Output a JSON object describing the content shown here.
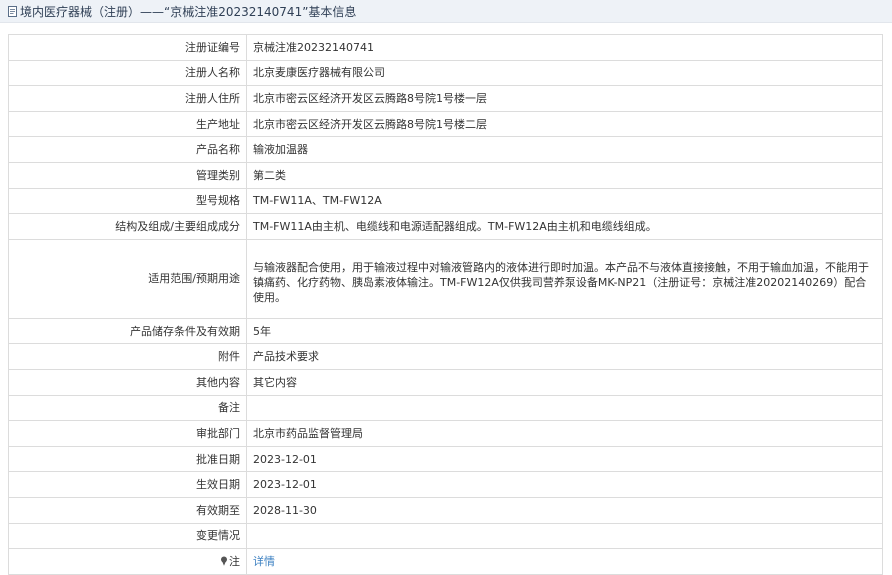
{
  "header": {
    "title": "境内医疗器械（注册）——“京械注准20232140741”基本信息",
    "icon": "document-icon"
  },
  "rows": [
    {
      "label": "注册证编号",
      "value": "京械注准20232140741"
    },
    {
      "label": "注册人名称",
      "value": "北京麦康医疗器械有限公司"
    },
    {
      "label": "注册人住所",
      "value": "北京市密云区经济开发区云腾路8号院1号楼一层"
    },
    {
      "label": "生产地址",
      "value": "北京市密云区经济开发区云腾路8号院1号楼二层"
    },
    {
      "label": "产品名称",
      "value": "输液加温器"
    },
    {
      "label": "管理类别",
      "value": "第二类"
    },
    {
      "label": "型号规格",
      "value": "TM-FW11A、TM-FW12A"
    },
    {
      "label": "结构及组成/主要组成成分",
      "value": "TM-FW11A由主机、电缆线和电源适配器组成。TM-FW12A由主机和电缆线组成。"
    },
    {
      "label": "适用范围/预期用途",
      "value": "与输液器配合使用，用于输液过程中对输液管路内的液体进行即时加温。本产品不与液体直接接触，不用于输血加温，不能用于镇痛药、化疗药物、胰岛素液体输注。TM-FW12A仅供我司营养泵设备MK-NP21（注册证号：京械注准20202140269）配合使用。"
    },
    {
      "label": "产品储存条件及有效期",
      "value": "5年"
    },
    {
      "label": "附件",
      "value": "产品技术要求"
    },
    {
      "label": "其他内容",
      "value": "其它内容"
    },
    {
      "label": "备注",
      "value": ""
    },
    {
      "label": "审批部门",
      "value": "北京市药品监督管理局"
    },
    {
      "label": "批准日期",
      "value": "2023-12-01"
    },
    {
      "label": "生效日期",
      "value": "2023-12-01"
    },
    {
      "label": "有效期至",
      "value": "2028-11-30"
    },
    {
      "label": "变更情况",
      "value": ""
    }
  ],
  "note": {
    "label": "注",
    "icon": "pin-icon",
    "link_text": "详情",
    "link_color": "#3a7fc1"
  }
}
